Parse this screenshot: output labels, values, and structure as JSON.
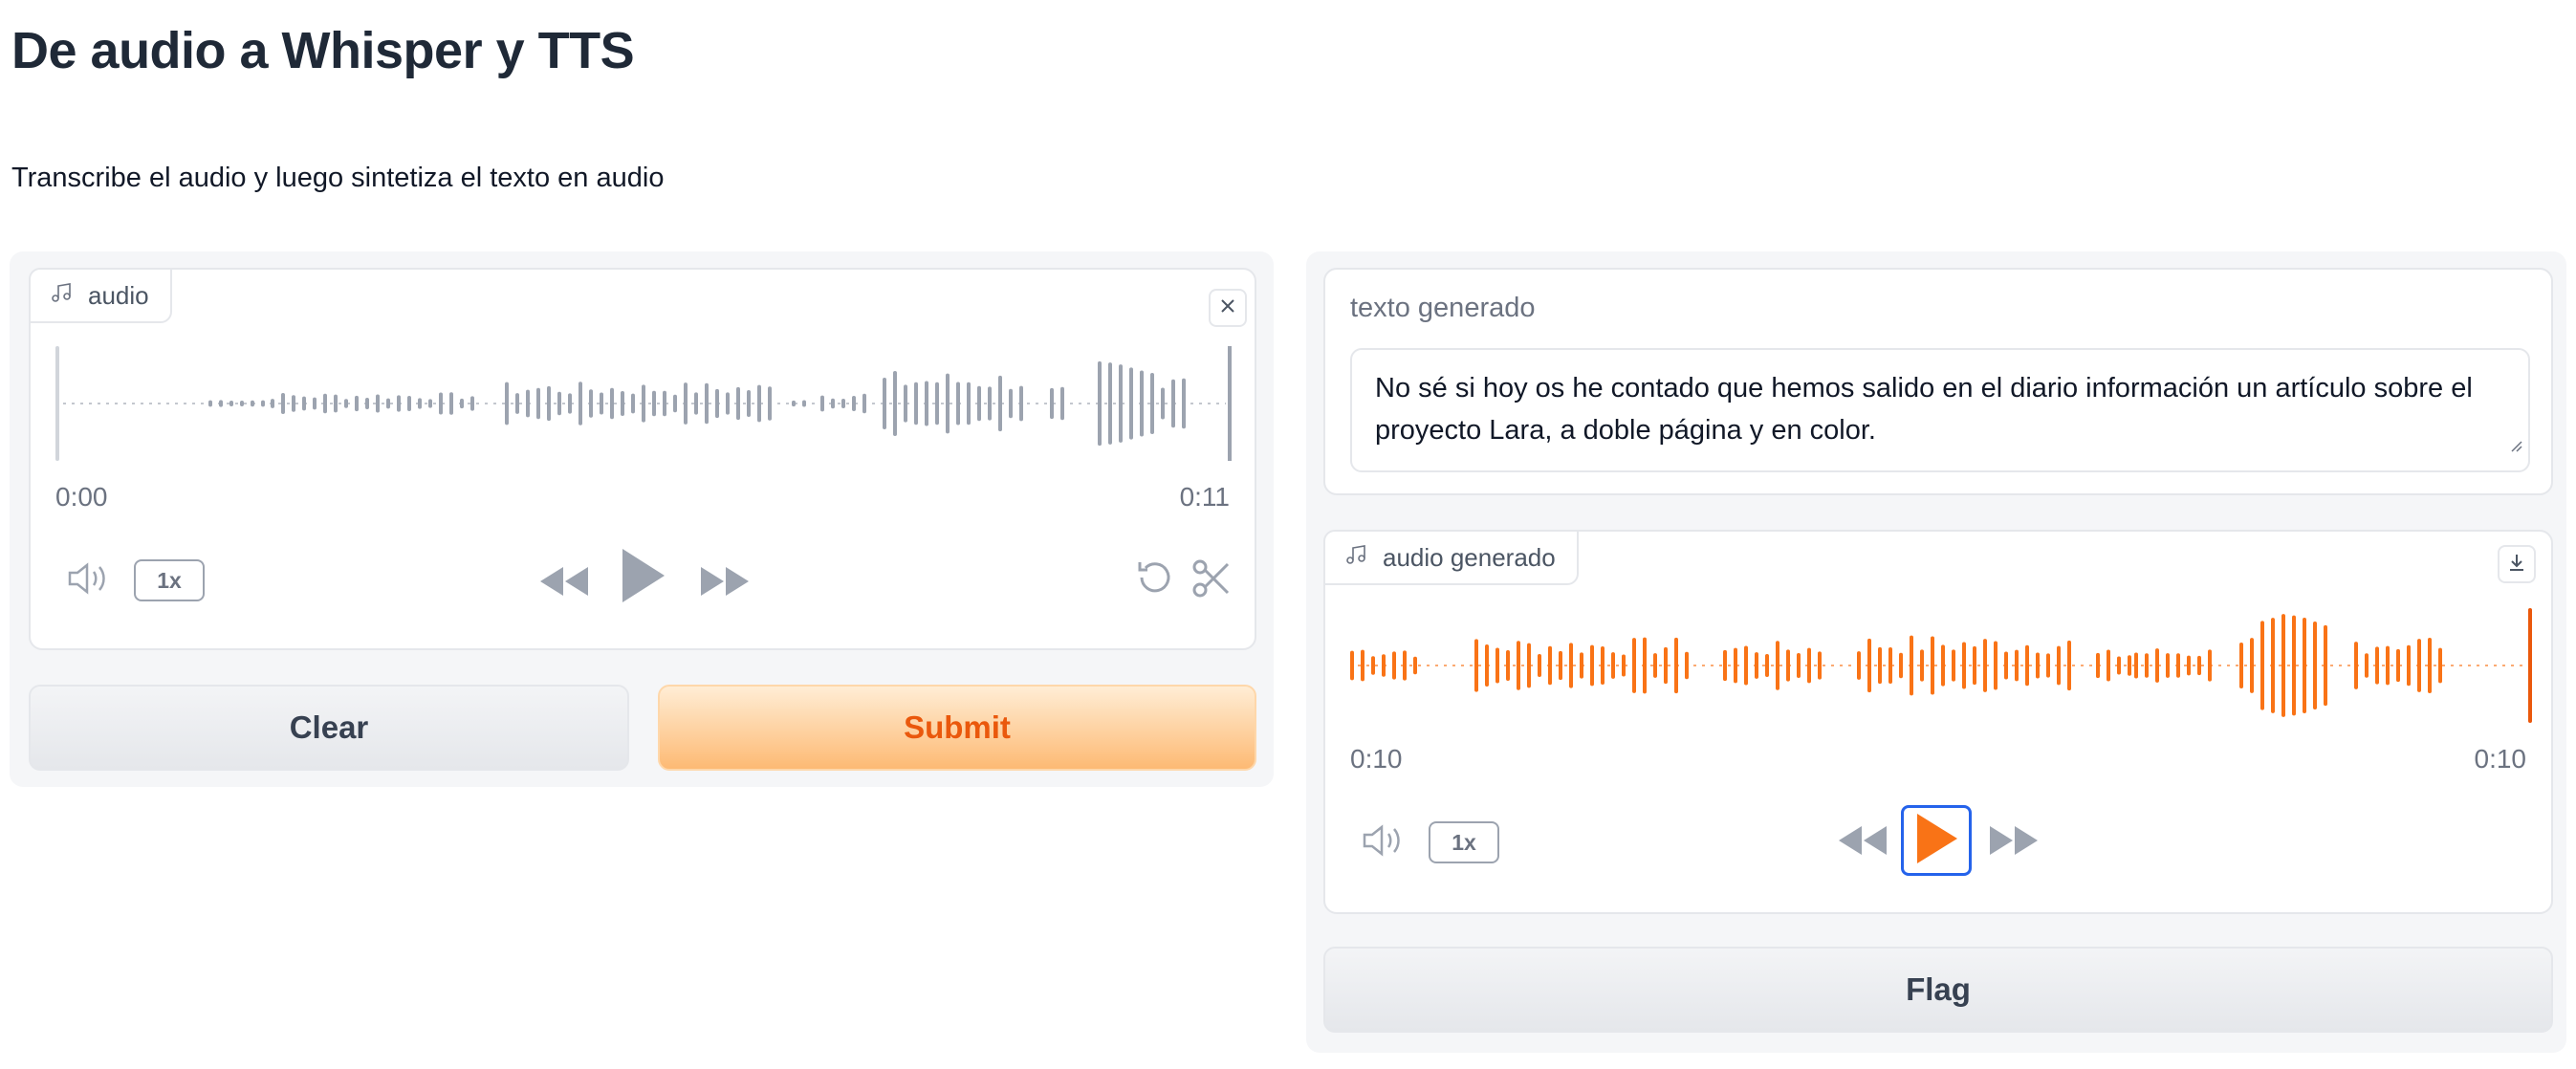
{
  "page": {
    "title": "De audio a Whisper y TTS",
    "description": "Transcribe el audio y luego sintetiza el texto en audio"
  },
  "input_audio": {
    "label": "audio",
    "icon": "music-note-icon",
    "time_start": "0:00",
    "time_end": "0:11",
    "speed": "1x",
    "waveform_color": "#9ca3af"
  },
  "buttons": {
    "clear": "Clear",
    "submit": "Submit",
    "flag": "Flag"
  },
  "output_text": {
    "label": "texto generado",
    "value": " No sé si hoy os he contado que hemos salido en el diario información un artículo sobre el proyecto Lara, a doble página y en color."
  },
  "output_audio": {
    "label": "audio generado",
    "icon": "music-note-icon",
    "time_start": "0:10",
    "time_end": "0:10",
    "speed": "1x",
    "waveform_color": "#f97316"
  },
  "colors": {
    "accent": "#f97316",
    "focus": "#2563eb",
    "muted": "#9ca3af"
  }
}
